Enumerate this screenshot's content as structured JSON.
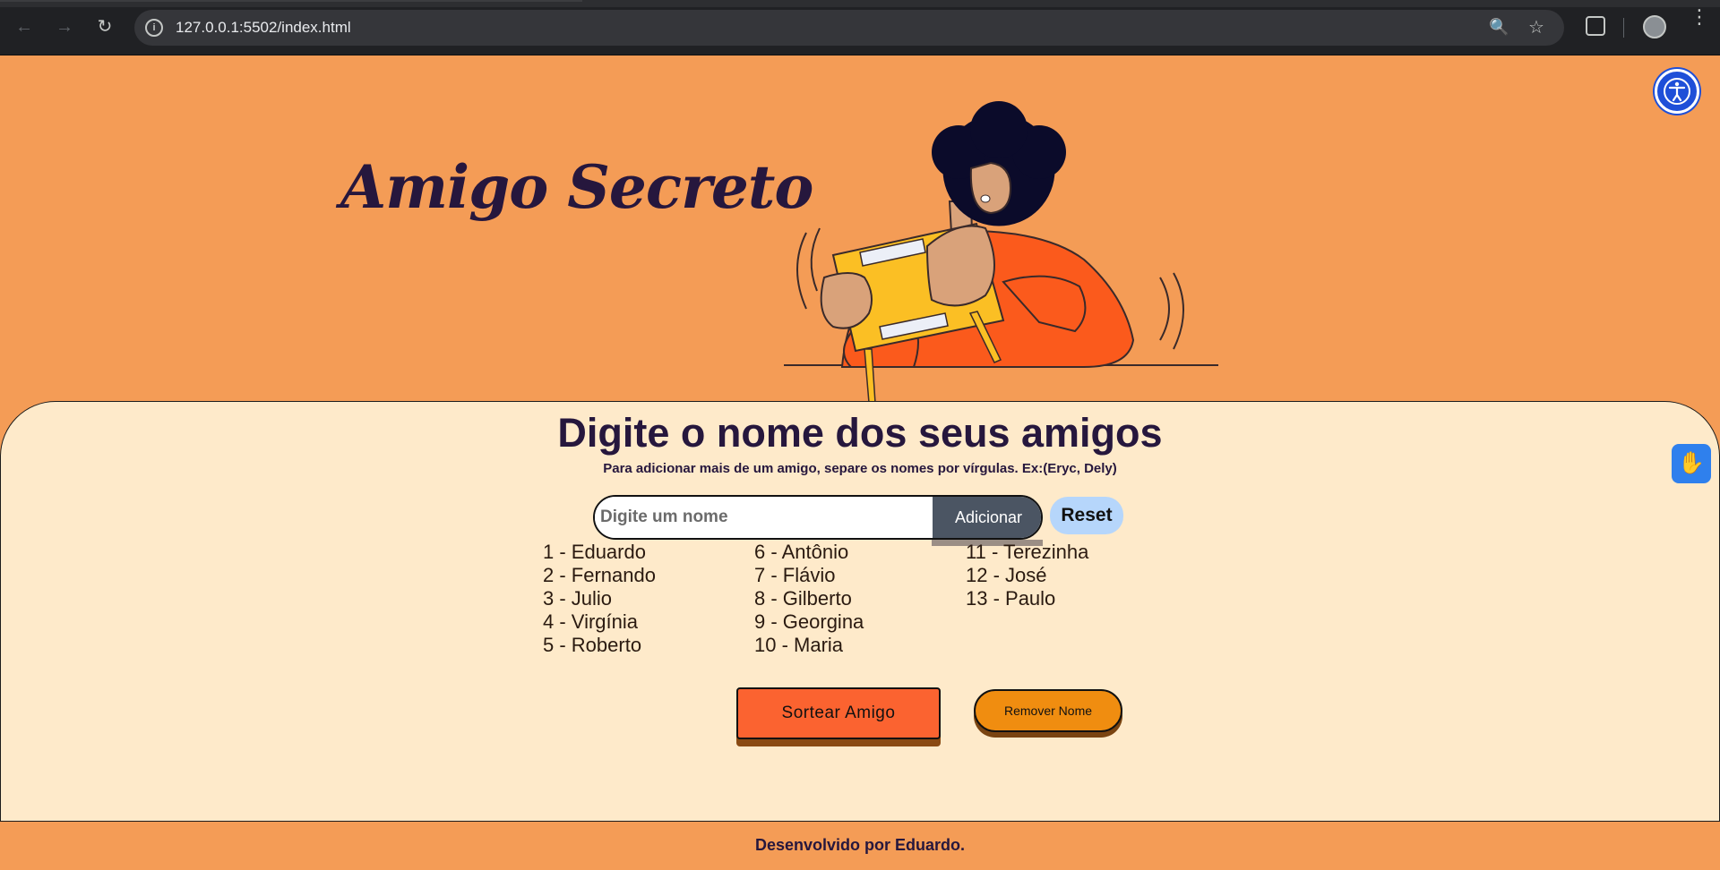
{
  "browser": {
    "url": "127.0.0.1:5502/index.html"
  },
  "header": {
    "title": "Amigo Secreto"
  },
  "main": {
    "heading": "Digite o nome dos seus amigos",
    "subheading": "Para adicionar mais de um amigo, separe os nomes por vírgulas. Ex:(Eryc, Dely)",
    "input_placeholder": "Digite um nome",
    "add_label": "Adicionar",
    "reset_label": "Reset",
    "friends": {
      "col1": [
        "1 - Eduardo",
        "2 - Fernando",
        "3 - Julio",
        "4 - Virgínia",
        "5 - Roberto"
      ],
      "col2": [
        "6 - Antônio",
        "7 - Flávio",
        "8 - Gilberto",
        "9 - Georgina",
        "10 - Maria"
      ],
      "col3": [
        "11 - Terezinha",
        "12 - José",
        "13 - Paulo"
      ]
    },
    "draw_label": "Sortear Amigo",
    "remove_label": "Remover Nome"
  },
  "footer": {
    "text": "Desenvolvido por Eduardo."
  },
  "colors": {
    "page_bg": "#f49c56",
    "panel_bg": "#feeaca",
    "draw_button": "#fb6330",
    "remove_button": "#f08d10",
    "reset_button": "#b6d6fb",
    "title_text": "#26173d"
  }
}
